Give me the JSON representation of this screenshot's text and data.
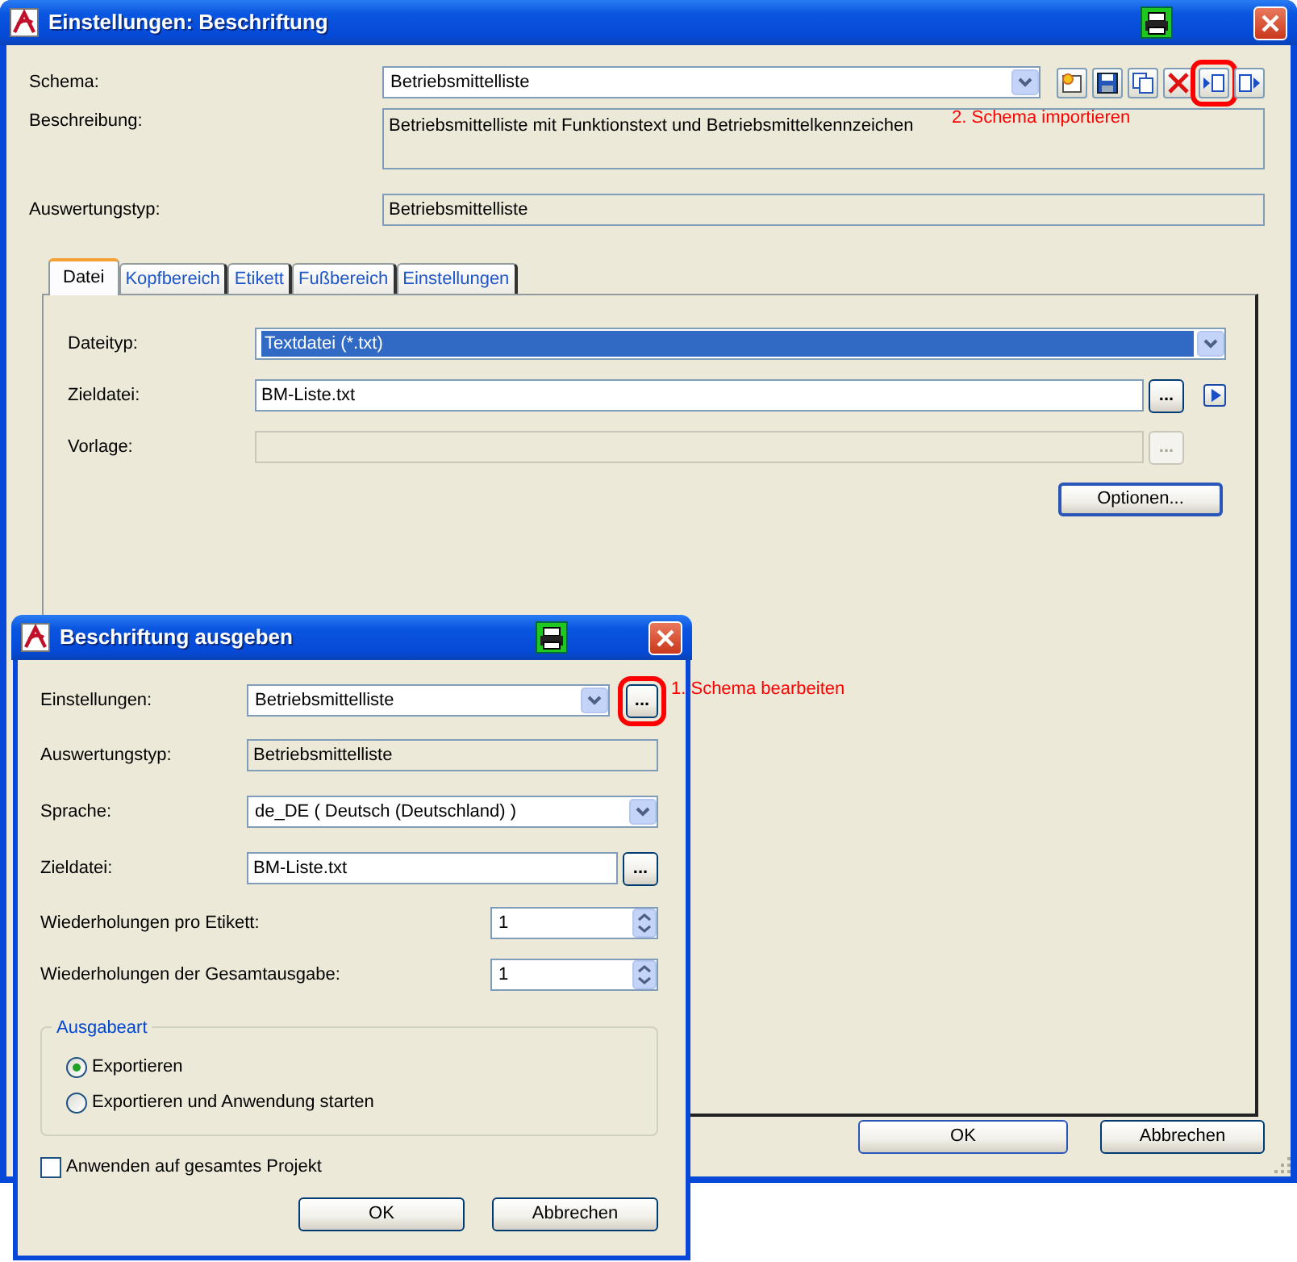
{
  "main_window": {
    "title": "Einstellungen: Beschriftung",
    "schema": {
      "label": "Schema:",
      "value": "Betriebsmittelliste"
    },
    "toolbar": [
      {
        "kind": "new",
        "highlighted": false
      },
      {
        "kind": "save",
        "highlighted": false
      },
      {
        "kind": "copy",
        "highlighted": false
      },
      {
        "kind": "delete",
        "highlighted": false
      },
      {
        "kind": "import",
        "highlighted": true
      },
      {
        "kind": "export",
        "highlighted": false
      }
    ],
    "annotation": "2. Schema importieren",
    "description": {
      "label": "Beschreibung:",
      "value": "Betriebsmittelliste mit Funktionstext und Betriebsmittelkennzeichen"
    },
    "evaluation_type": {
      "label": "Auswertungstyp:",
      "value": "Betriebsmittelliste"
    },
    "tabs": [
      {
        "label": "Datei",
        "selected": true
      },
      {
        "label": "Kopfbereich",
        "selected": false
      },
      {
        "label": "Etikett",
        "selected": false
      },
      {
        "label": "Fußbereich",
        "selected": false
      },
      {
        "label": "Einstellungen",
        "selected": false
      }
    ],
    "fields": [
      {
        "kind": "combo",
        "label": "Dateityp:",
        "value": "Textdatei (*.txt)",
        "value_selected": true,
        "disabled": false
      },
      {
        "kind": "file_run",
        "label": "Zieldatei:",
        "value": "BM-Liste.txt",
        "button": "...",
        "disabled": false
      },
      {
        "kind": "file",
        "label": "Vorlage:",
        "button": "...",
        "disabled": true
      }
    ],
    "options_button": "Optionen...",
    "buttons": [
      "OK",
      "Abbrechen"
    ]
  },
  "dialog": {
    "title": "Beschriftung ausgeben",
    "annotation": "1. Schema bearbeiten",
    "fields": [
      {
        "kind": "combo_button",
        "label": "Einstellungen:",
        "value": "Betriebsmittelliste",
        "button": "...",
        "highlighted": true
      },
      {
        "kind": "readonly",
        "label": "Auswertungstyp:",
        "value": "Betriebsmittelliste"
      },
      {
        "kind": "combo",
        "label": "Sprache:",
        "value": "de_DE ( Deutsch (Deutschland) )"
      },
      {
        "kind": "file",
        "label": "Zieldatei:",
        "value": "BM-Liste.txt",
        "button": "..."
      },
      {
        "kind": "spin",
        "label": "Wiederholungen pro Etikett:",
        "value": "1"
      },
      {
        "kind": "spin",
        "label": "Wiederholungen der Gesamtausgabe:",
        "value": "1"
      }
    ],
    "output_type": {
      "title": "Ausgabeart",
      "options": [
        {
          "label": "Exportieren",
          "selected": true
        },
        {
          "label": "Exportieren und Anwendung starten",
          "selected": false
        }
      ]
    },
    "apply_all": {
      "label": "Anwenden auf gesamtes Projekt",
      "checked": false
    },
    "buttons": [
      "OK",
      "Abbrechen"
    ]
  }
}
